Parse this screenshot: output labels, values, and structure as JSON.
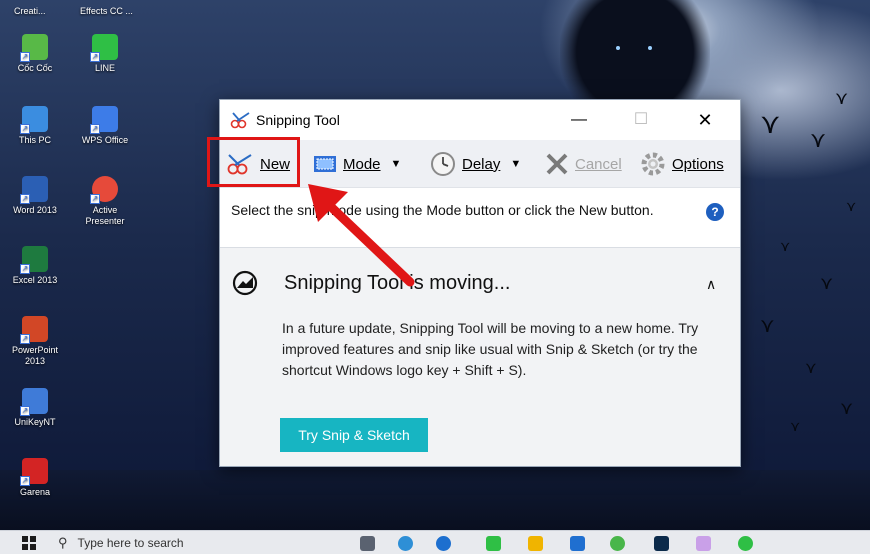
{
  "desktop": {
    "top_labels": [
      "Creati...",
      "Effects CC ..."
    ],
    "icons": [
      {
        "label": "Cốc Cốc",
        "color": "#58b947"
      },
      {
        "label": "LINE",
        "color": "#2fbf45"
      },
      {
        "label": "This PC",
        "color": "#3b8de0"
      },
      {
        "label": "WPS Office",
        "color": "#3d7ce8"
      },
      {
        "label": "Word 2013",
        "color": "#2b5fb4"
      },
      {
        "label": "Active Presenter",
        "color": "#e64a3a"
      },
      {
        "label": "Excel 2013",
        "color": "#1e7a3f"
      },
      {
        "label": "PowerPoint 2013",
        "color": "#d24726"
      },
      {
        "label": "UniKeyNT",
        "color": "#3f7bd8"
      },
      {
        "label": "Garena",
        "color": "#d32424"
      }
    ]
  },
  "window": {
    "title": "Snipping Tool",
    "min_glyph": "—",
    "max_glyph": "☐",
    "close_glyph": "✕",
    "toolbar": {
      "new_label": "New",
      "mode_label": "Mode",
      "delay_label": "Delay",
      "cancel_label": "Cancel",
      "options_label": "Options",
      "dropdown_glyph": "▼"
    },
    "hint_text": "Select the snip mode using the Mode button or click the New button.",
    "help_glyph": "?",
    "notice": {
      "title": "Snipping Tool is moving...",
      "collapse_glyph": "∧",
      "body": "In a future update, Snipping Tool will be moving to a new home. Try improved features and snip like usual with Snip & Sketch (or try the shortcut Windows logo key + Shift + S).",
      "button_label": "Try Snip & Sketch"
    }
  },
  "taskbar": {
    "search_placeholder": "Type here to search",
    "search_glyph": "⚲",
    "pinned": [
      {
        "name": "task-view",
        "color": "#5a6270"
      },
      {
        "name": "coccoc",
        "color": "#2e8fd6"
      },
      {
        "name": "edge",
        "color": "#1d6fcf"
      },
      {
        "name": "line-app",
        "color": "#2fbf45"
      },
      {
        "name": "file-explorer",
        "color": "#f0b400"
      },
      {
        "name": "mail",
        "color": "#1f6fd0"
      },
      {
        "name": "coccoc-alt",
        "color": "#49b64a"
      },
      {
        "name": "photoshop",
        "color": "#0b2a4a"
      },
      {
        "name": "paint",
        "color": "#c9a0e8"
      },
      {
        "name": "line-alt",
        "color": "#2fbf45"
      }
    ]
  },
  "colors": {
    "annotation_red": "#e01616",
    "accent_teal": "#17b5c2",
    "help_blue": "#1e5fbf"
  }
}
